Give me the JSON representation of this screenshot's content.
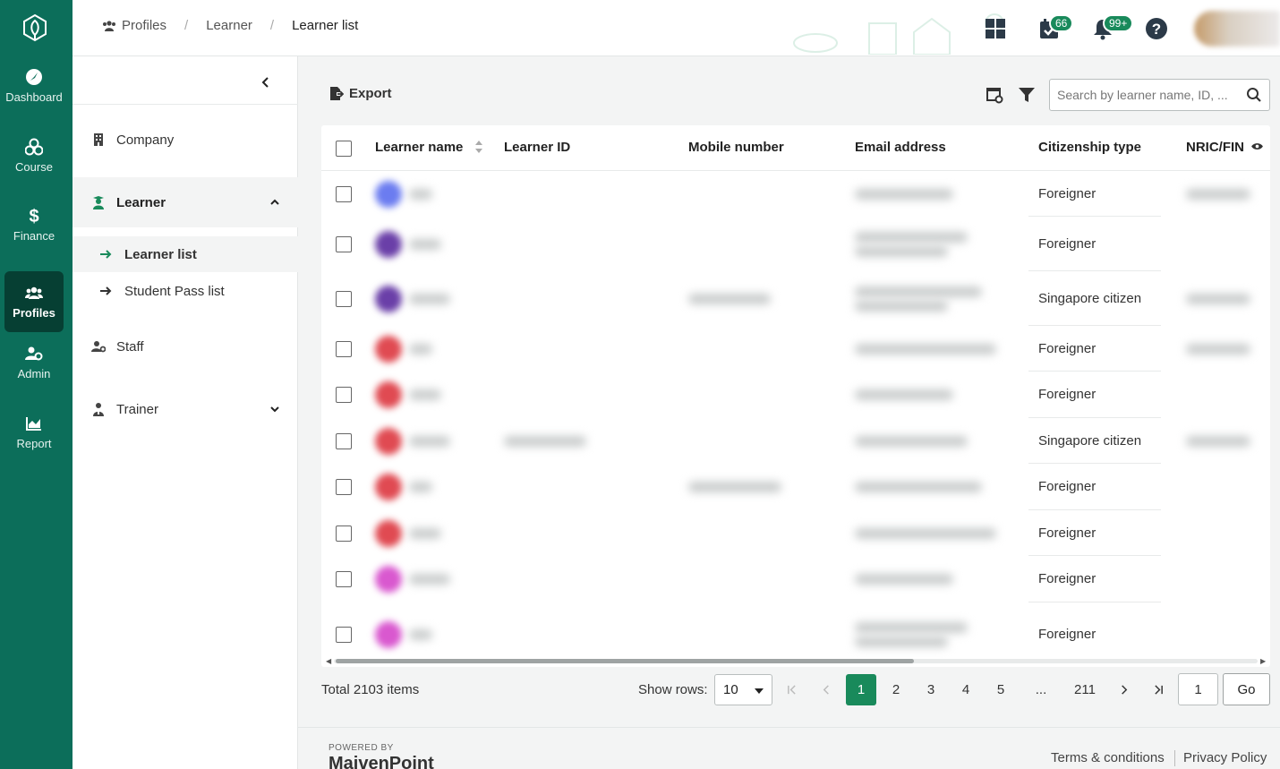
{
  "rail": {
    "items": [
      {
        "label": "Dashboard",
        "icon": "dashboard-icon"
      },
      {
        "label": "Course",
        "icon": "course-icon"
      },
      {
        "label": "Finance",
        "icon": "dollar-icon"
      },
      {
        "label": "Profiles",
        "icon": "users-icon",
        "active": true
      },
      {
        "label": "Admin",
        "icon": "admin-icon"
      },
      {
        "label": "Report",
        "icon": "chart-icon"
      }
    ]
  },
  "breadcrumb": {
    "root": "Profiles",
    "middle": "Learner",
    "current": "Learner list"
  },
  "header": {
    "task_badge": "66",
    "notif_badge": "99+"
  },
  "subnav": {
    "company": "Company",
    "learner": "Learner",
    "learner_list": "Learner list",
    "student_pass_list": "Student Pass list",
    "staff": "Staff",
    "trainer": "Trainer"
  },
  "toolbar": {
    "export_label": "Export",
    "search_placeholder": "Search by learner name, ID, ..."
  },
  "table": {
    "columns": [
      "Learner name",
      "Learner ID",
      "Mobile number",
      "Email address",
      "Citizenship type",
      "NRIC/FIN"
    ],
    "rows": [
      {
        "citizenship": "Foreigner"
      },
      {
        "citizenship": "Foreigner"
      },
      {
        "citizenship": "Singapore citizen"
      },
      {
        "citizenship": "Foreigner"
      },
      {
        "citizenship": "Foreigner"
      },
      {
        "citizenship": "Singapore citizen"
      },
      {
        "citizenship": "Foreigner"
      },
      {
        "citizenship": "Foreigner"
      },
      {
        "citizenship": "Foreigner"
      },
      {
        "citizenship": "Foreigner"
      }
    ]
  },
  "pagination": {
    "total": "Total 2103 items",
    "show_rows_label": "Show rows:",
    "rows_value": "10",
    "pages": [
      "1",
      "2",
      "3",
      "4",
      "5",
      "...",
      "211"
    ],
    "goto_value": "1",
    "go_label": "Go"
  },
  "footer": {
    "powered_by": "POWERED BY",
    "brand": "MaivenPoint",
    "terms": "Terms & conditions",
    "privacy": "Privacy Policy"
  },
  "colors": {
    "rail": "#0c6e5a",
    "rail_active": "#063f33",
    "accent": "#198a5b"
  }
}
